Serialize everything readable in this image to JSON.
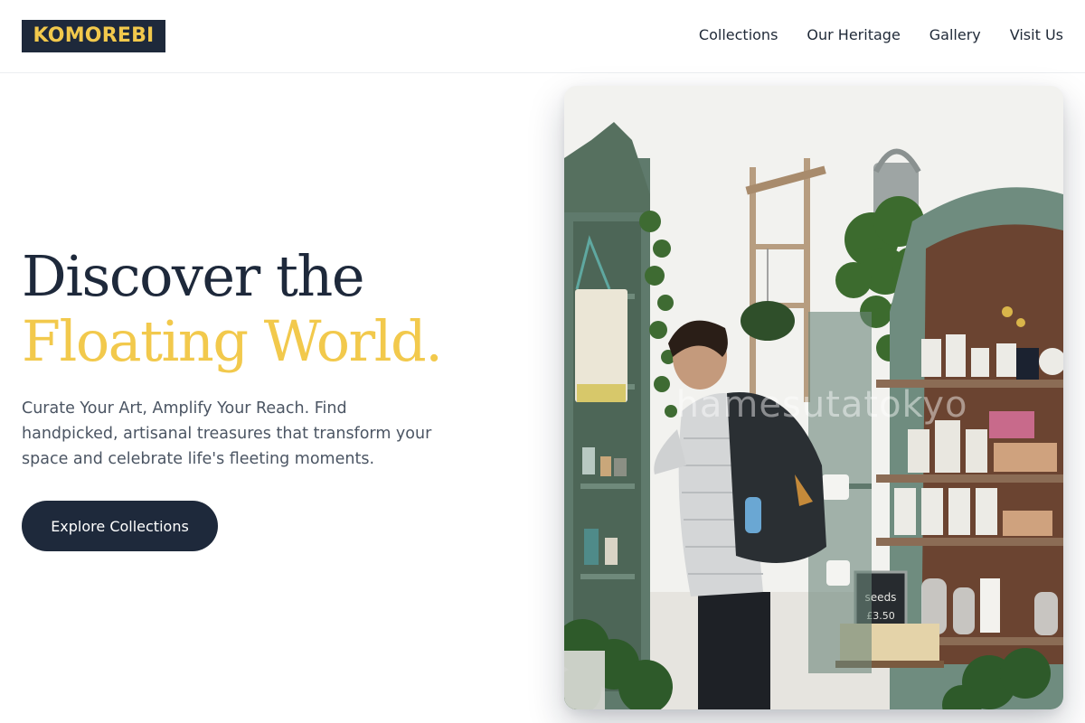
{
  "brand": {
    "logo_text": "KOMOREBI",
    "logo_bg": "#1e293b",
    "logo_color": "#f2c94c"
  },
  "nav": {
    "items": [
      {
        "label": "Collections"
      },
      {
        "label": "Our Heritage"
      },
      {
        "label": "Gallery"
      },
      {
        "label": "Visit Us"
      }
    ]
  },
  "hero": {
    "headline_line1": "Discover the",
    "headline_line2": "Floating World.",
    "subtext": "Curate Your Art, Amplify Your Reach. Find handpicked, artisanal treasures that transform your space and celebrate life's fleeting moments.",
    "cta_label": "Explore Collections",
    "accent_color": "#f2c94c",
    "primary_color": "#1e293b",
    "image": {
      "watermark": "hamesutatokyo",
      "sign_line1": "seeds",
      "sign_line2": "£3.50"
    }
  }
}
